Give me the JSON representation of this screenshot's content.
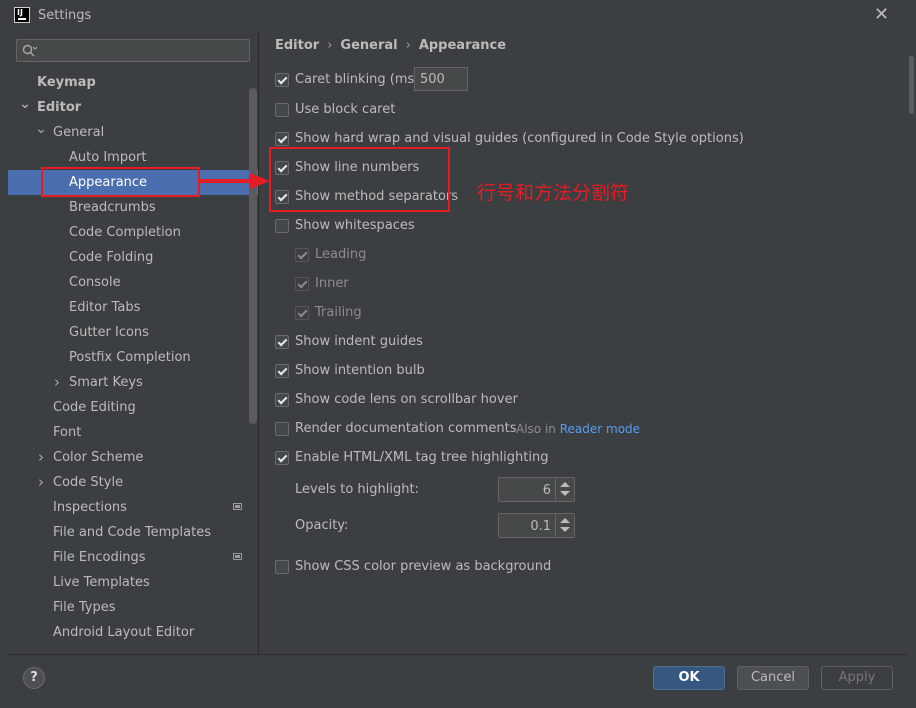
{
  "window": {
    "title": "Settings",
    "app_icon_text": "IJ"
  },
  "search": {
    "value": "",
    "placeholder": ""
  },
  "sidebar": {
    "items": [
      {
        "label": "Keymap",
        "indent": 0,
        "bold": true,
        "chevron": ""
      },
      {
        "label": "Editor",
        "indent": 0,
        "bold": true,
        "chevron": "down"
      },
      {
        "label": "General",
        "indent": 1,
        "bold": false,
        "chevron": "down"
      },
      {
        "label": "Auto Import",
        "indent": 2,
        "bold": false,
        "chevron": ""
      },
      {
        "label": "Appearance",
        "indent": 2,
        "bold": false,
        "chevron": "",
        "selected": true
      },
      {
        "label": "Breadcrumbs",
        "indent": 2,
        "bold": false,
        "chevron": ""
      },
      {
        "label": "Code Completion",
        "indent": 2,
        "bold": false,
        "chevron": ""
      },
      {
        "label": "Code Folding",
        "indent": 2,
        "bold": false,
        "chevron": ""
      },
      {
        "label": "Console",
        "indent": 2,
        "bold": false,
        "chevron": ""
      },
      {
        "label": "Editor Tabs",
        "indent": 2,
        "bold": false,
        "chevron": ""
      },
      {
        "label": "Gutter Icons",
        "indent": 2,
        "bold": false,
        "chevron": ""
      },
      {
        "label": "Postfix Completion",
        "indent": 2,
        "bold": false,
        "chevron": ""
      },
      {
        "label": "Smart Keys",
        "indent": 2,
        "bold": false,
        "chevron": "right"
      },
      {
        "label": "Code Editing",
        "indent": 1,
        "bold": false,
        "chevron": ""
      },
      {
        "label": "Font",
        "indent": 1,
        "bold": false,
        "chevron": ""
      },
      {
        "label": "Color Scheme",
        "indent": 1,
        "bold": false,
        "chevron": "right"
      },
      {
        "label": "Code Style",
        "indent": 1,
        "bold": false,
        "chevron": "right"
      },
      {
        "label": "Inspections",
        "indent": 1,
        "bold": false,
        "chevron": "",
        "badge": "project-scope-icon"
      },
      {
        "label": "File and Code Templates",
        "indent": 1,
        "bold": false,
        "chevron": ""
      },
      {
        "label": "File Encodings",
        "indent": 1,
        "bold": false,
        "chevron": "",
        "badge": "project-scope-icon"
      },
      {
        "label": "Live Templates",
        "indent": 1,
        "bold": false,
        "chevron": ""
      },
      {
        "label": "File Types",
        "indent": 1,
        "bold": false,
        "chevron": ""
      },
      {
        "label": "Android Layout Editor",
        "indent": 1,
        "bold": false,
        "chevron": ""
      }
    ]
  },
  "breadcrumb": {
    "part1": "Editor",
    "part2": "General",
    "part3": "Appearance",
    "separator": "›"
  },
  "options": {
    "caret_blinking": {
      "label": "Caret blinking (ms):",
      "checked": true,
      "value": "500"
    },
    "block_caret": {
      "label": "Use block caret",
      "checked": false
    },
    "hard_wrap": {
      "label": "Show hard wrap and visual guides (configured in Code Style options)",
      "checked": true
    },
    "line_numbers": {
      "label": "Show line numbers",
      "checked": true
    },
    "method_separators": {
      "label": "Show method separators",
      "checked": true
    },
    "whitespaces": {
      "label": "Show whitespaces",
      "checked": false
    },
    "leading": {
      "label": "Leading",
      "checked": true,
      "disabled": true
    },
    "inner": {
      "label": "Inner",
      "checked": true,
      "disabled": true
    },
    "trailing": {
      "label": "Trailing",
      "checked": true,
      "disabled": true
    },
    "indent_guides": {
      "label": "Show indent guides",
      "checked": true
    },
    "intention_bulb": {
      "label": "Show intention bulb",
      "checked": true
    },
    "code_lens": {
      "label": "Show code lens on scrollbar hover",
      "checked": true
    },
    "render_docs": {
      "label": "Render documentation comments",
      "checked": false,
      "also_prefix": "Also in",
      "also_link": "Reader mode"
    },
    "tag_tree": {
      "label": "Enable HTML/XML tag tree highlighting",
      "checked": true
    },
    "levels": {
      "label": "Levels to highlight:",
      "value": "6"
    },
    "opacity": {
      "label": "Opacity:",
      "value": "0.1"
    },
    "css_preview": {
      "label": "Show CSS color preview as background",
      "checked": false
    }
  },
  "annotation": {
    "text": "行号和方法分割符",
    "color": "#e51c23"
  },
  "footer": {
    "help": "?",
    "ok": "OK",
    "cancel": "Cancel",
    "apply": "Apply"
  },
  "colors": {
    "background": "#3c3f41",
    "selection": "#4b6eaf",
    "primary_button": "#365880",
    "link": "#589df6"
  }
}
